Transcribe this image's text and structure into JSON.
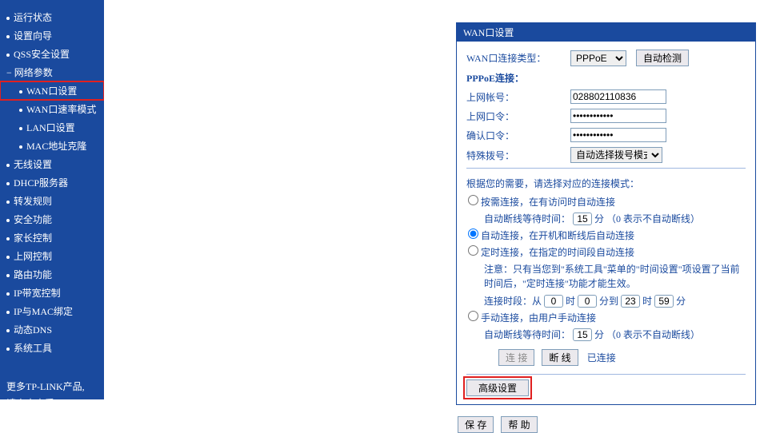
{
  "sidebar": {
    "items": [
      {
        "label": "运行状态",
        "type": "top"
      },
      {
        "label": "设置向导",
        "type": "top"
      },
      {
        "label": "QSS安全设置",
        "type": "top"
      },
      {
        "label": "网络参数",
        "type": "expand"
      },
      {
        "label": "WAN口设置",
        "type": "sub",
        "active": true
      },
      {
        "label": "WAN口速率模式",
        "type": "sub"
      },
      {
        "label": "LAN口设置",
        "type": "sub"
      },
      {
        "label": "MAC地址克隆",
        "type": "sub"
      },
      {
        "label": "无线设置",
        "type": "top"
      },
      {
        "label": "DHCP服务器",
        "type": "top"
      },
      {
        "label": "转发规则",
        "type": "top"
      },
      {
        "label": "安全功能",
        "type": "top"
      },
      {
        "label": "家长控制",
        "type": "top"
      },
      {
        "label": "上网控制",
        "type": "top"
      },
      {
        "label": "路由功能",
        "type": "top"
      },
      {
        "label": "IP带宽控制",
        "type": "top"
      },
      {
        "label": "IP与MAC绑定",
        "type": "top"
      },
      {
        "label": "动态DNS",
        "type": "top"
      },
      {
        "label": "系统工具",
        "type": "top"
      }
    ],
    "footer1": "更多TP-LINK产品,",
    "footer2": "请点击查看 >>"
  },
  "panel": {
    "title": "WAN口设置",
    "wan_type_label": "WAN口连接类型：",
    "wan_type_value": "PPPoE",
    "auto_detect": "自动检测",
    "pppoe_label": "PPPoE连接：",
    "account_label": "上网帐号：",
    "account_value": "028802110836",
    "password_label": "上网口令：",
    "password_value": "●●●●●●●●●●●●",
    "confirm_label": "确认口令：",
    "confirm_value": "●●●●●●●●●●●●",
    "dial_label": "特殊拨号：",
    "dial_value": "自动选择拨号模式",
    "mode_prompt": "根据您的需要，请选择对应的连接模式：",
    "mode1": "按需连接，在有访问时自动连接",
    "mode1_sub_pre": "自动断线等待时间：",
    "mode1_time": "15",
    "mode1_sub_post": "分 （0 表示不自动断线）",
    "mode2": "自动连接，在开机和断线后自动连接",
    "mode3": "定时连接，在指定的时间段自动连接",
    "mode3_note": "注意：只有当您到\"系统工具\"菜单的\"时间设置\"项设置了当前时间后，\"定时连接\"功能才能生效。",
    "mode3_period_pre": "连接时段：从",
    "mode3_h1": "0",
    "mode3_hour": "时",
    "mode3_m1": "0",
    "mode3_min_to": "分到",
    "mode3_h2": "23",
    "mode3_m2": "59",
    "mode3_min": "分",
    "mode4": "手动连接，由用户手动连接",
    "mode4_sub_pre": "自动断线等待时间：",
    "mode4_time": "15",
    "mode4_sub_post": "分 （0 表示不自动断线）",
    "btn_connect": "连 接",
    "btn_disconnect": "断 线",
    "status": "已连接",
    "btn_advanced": "高级设置",
    "btn_save": "保 存",
    "btn_help": "帮 助"
  }
}
